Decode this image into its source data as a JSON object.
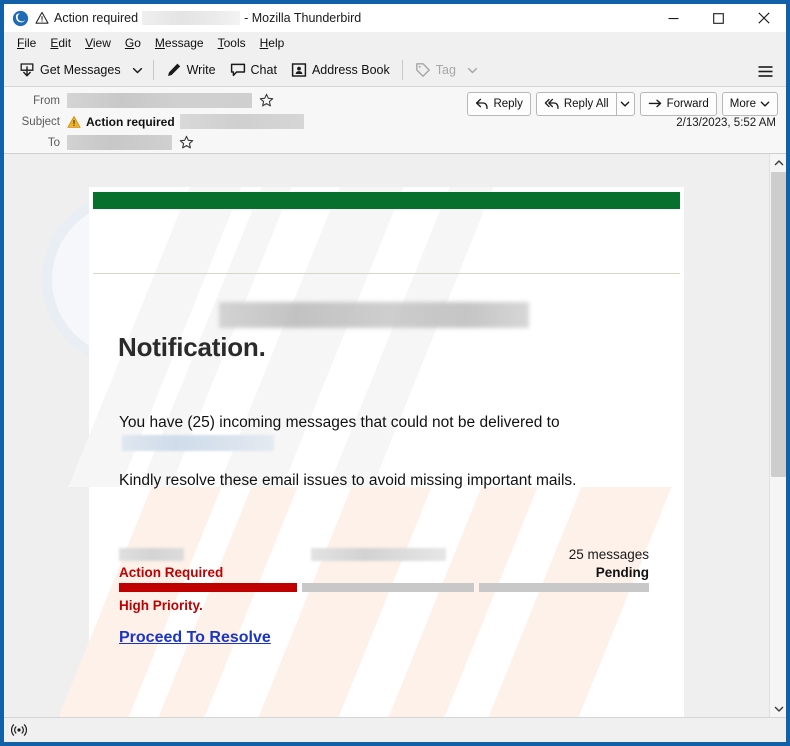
{
  "window": {
    "title_prefix": "Action required",
    "title_suffix": "- Mozilla Thunderbird",
    "app_icon": "thunderbird-logo-icon",
    "warning_icon": "warning-triangle-icon",
    "redacted_sender": "",
    "controls": {
      "minimize": "—",
      "maximize": "☐",
      "close": "✕"
    },
    "border_color": "#1261a8"
  },
  "menubar": {
    "items": [
      {
        "name": "file",
        "accel": "F",
        "rest": "ile"
      },
      {
        "name": "edit",
        "accel": "E",
        "rest": "dit"
      },
      {
        "name": "view",
        "accel": "V",
        "rest": "iew"
      },
      {
        "name": "go",
        "accel": "G",
        "rest": "o"
      },
      {
        "name": "message",
        "accel": "M",
        "rest": "essage"
      },
      {
        "name": "tools",
        "accel": "T",
        "rest": "ools"
      },
      {
        "name": "help",
        "accel": "H",
        "rest": "elp"
      }
    ]
  },
  "toolbar": {
    "get_messages_label": "Get Messages",
    "get_messages_icon": "inbox-download-icon",
    "get_messages_caret": "chevron-down-icon",
    "write_label": "Write",
    "write_icon": "pencil-icon",
    "chat_label": "Chat",
    "chat_icon": "speech-bubble-icon",
    "address_book_label": "Address Book",
    "address_book_icon": "contact-card-icon",
    "tag_label": "Tag",
    "tag_icon": "tag-icon",
    "tag_caret": "chevron-down-icon",
    "tag_disabled": true,
    "app_menu_icon": "hamburger-menu-icon"
  },
  "message_header": {
    "from_label": "From",
    "from_value_redacted": "",
    "from_star_icon": "star-outline-icon",
    "subject_label": "Subject",
    "subject_warning_icon": "warning-triangle-icon",
    "subject_value": "Action required",
    "subject_value_redacted": "",
    "to_label": "To",
    "to_value_redacted": "",
    "to_star_icon": "star-outline-icon",
    "date": "2/13/2023, 5:52 AM",
    "actions": {
      "reply_label": "Reply",
      "reply_icon": "reply-arrow-icon",
      "reply_all_label": "Reply All",
      "reply_all_icon": "reply-all-arrow-icon",
      "reply_all_caret": "chevron-down-icon",
      "forward_label": "Forward",
      "forward_icon": "forward-arrow-icon",
      "more_label": "More",
      "more_caret": "chevron-down-icon"
    }
  },
  "email_body": {
    "accent_bar_color": "#06702c",
    "divider_color": "#cfd9c4",
    "brand_redacted": "",
    "heading": "Notification.",
    "paragraph_1_before": "You have (25) incoming messages that could not be delivered to",
    "paragraph_1_redacted": "",
    "paragraph_2": "Kindly resolve these email issues to avoid missing important mails.",
    "status": {
      "label_redacted_a": "",
      "label_redacted_b": "",
      "count_text": "25 messages",
      "action_text": "Action Required",
      "pending_text": "Pending",
      "priority_text": "High Priority.",
      "bar_filled_color": "#c00000",
      "bar_empty_color": "#c8c8c8",
      "bars": [
        {
          "name": "action-required-bar",
          "fill": 100
        },
        {
          "name": "second-bar",
          "fill": 0
        },
        {
          "name": "third-bar",
          "fill": 0
        }
      ]
    },
    "cta_label": "Proceed To Resolve",
    "cta_color": "#1a34c8"
  },
  "scrollbar": {
    "up_icon": "chevron-up-icon",
    "down_icon": "chevron-down-icon",
    "thumb_name": "scrollbar-thumb"
  },
  "statusbar": {
    "connection_icon": "connection-online-icon",
    "text": ""
  }
}
